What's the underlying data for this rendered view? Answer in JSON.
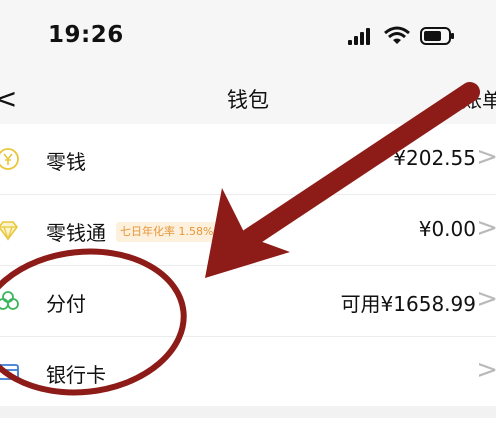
{
  "status": {
    "time": "19:26"
  },
  "nav": {
    "back_glyph": "<",
    "title": "钱包",
    "right_label": "账单"
  },
  "rows": [
    {
      "icon": "yuan-coin-icon",
      "label": "零钱",
      "value": "¥202.55"
    },
    {
      "icon": "diamond-icon",
      "label": "零钱通",
      "badge": "七日年化率 1.58%",
      "value": "¥0.00"
    },
    {
      "icon": "installment-icon",
      "label": "分付",
      "value": "可用¥1658.99"
    },
    {
      "icon": "bank-card-icon",
      "label": "银行卡",
      "value": ""
    }
  ],
  "chevron": ">",
  "colors": {
    "annotation": "#8d1b17",
    "badge_text": "#e5963a",
    "icon_yellow": "#e8c73c",
    "icon_green": "#3db55c"
  }
}
